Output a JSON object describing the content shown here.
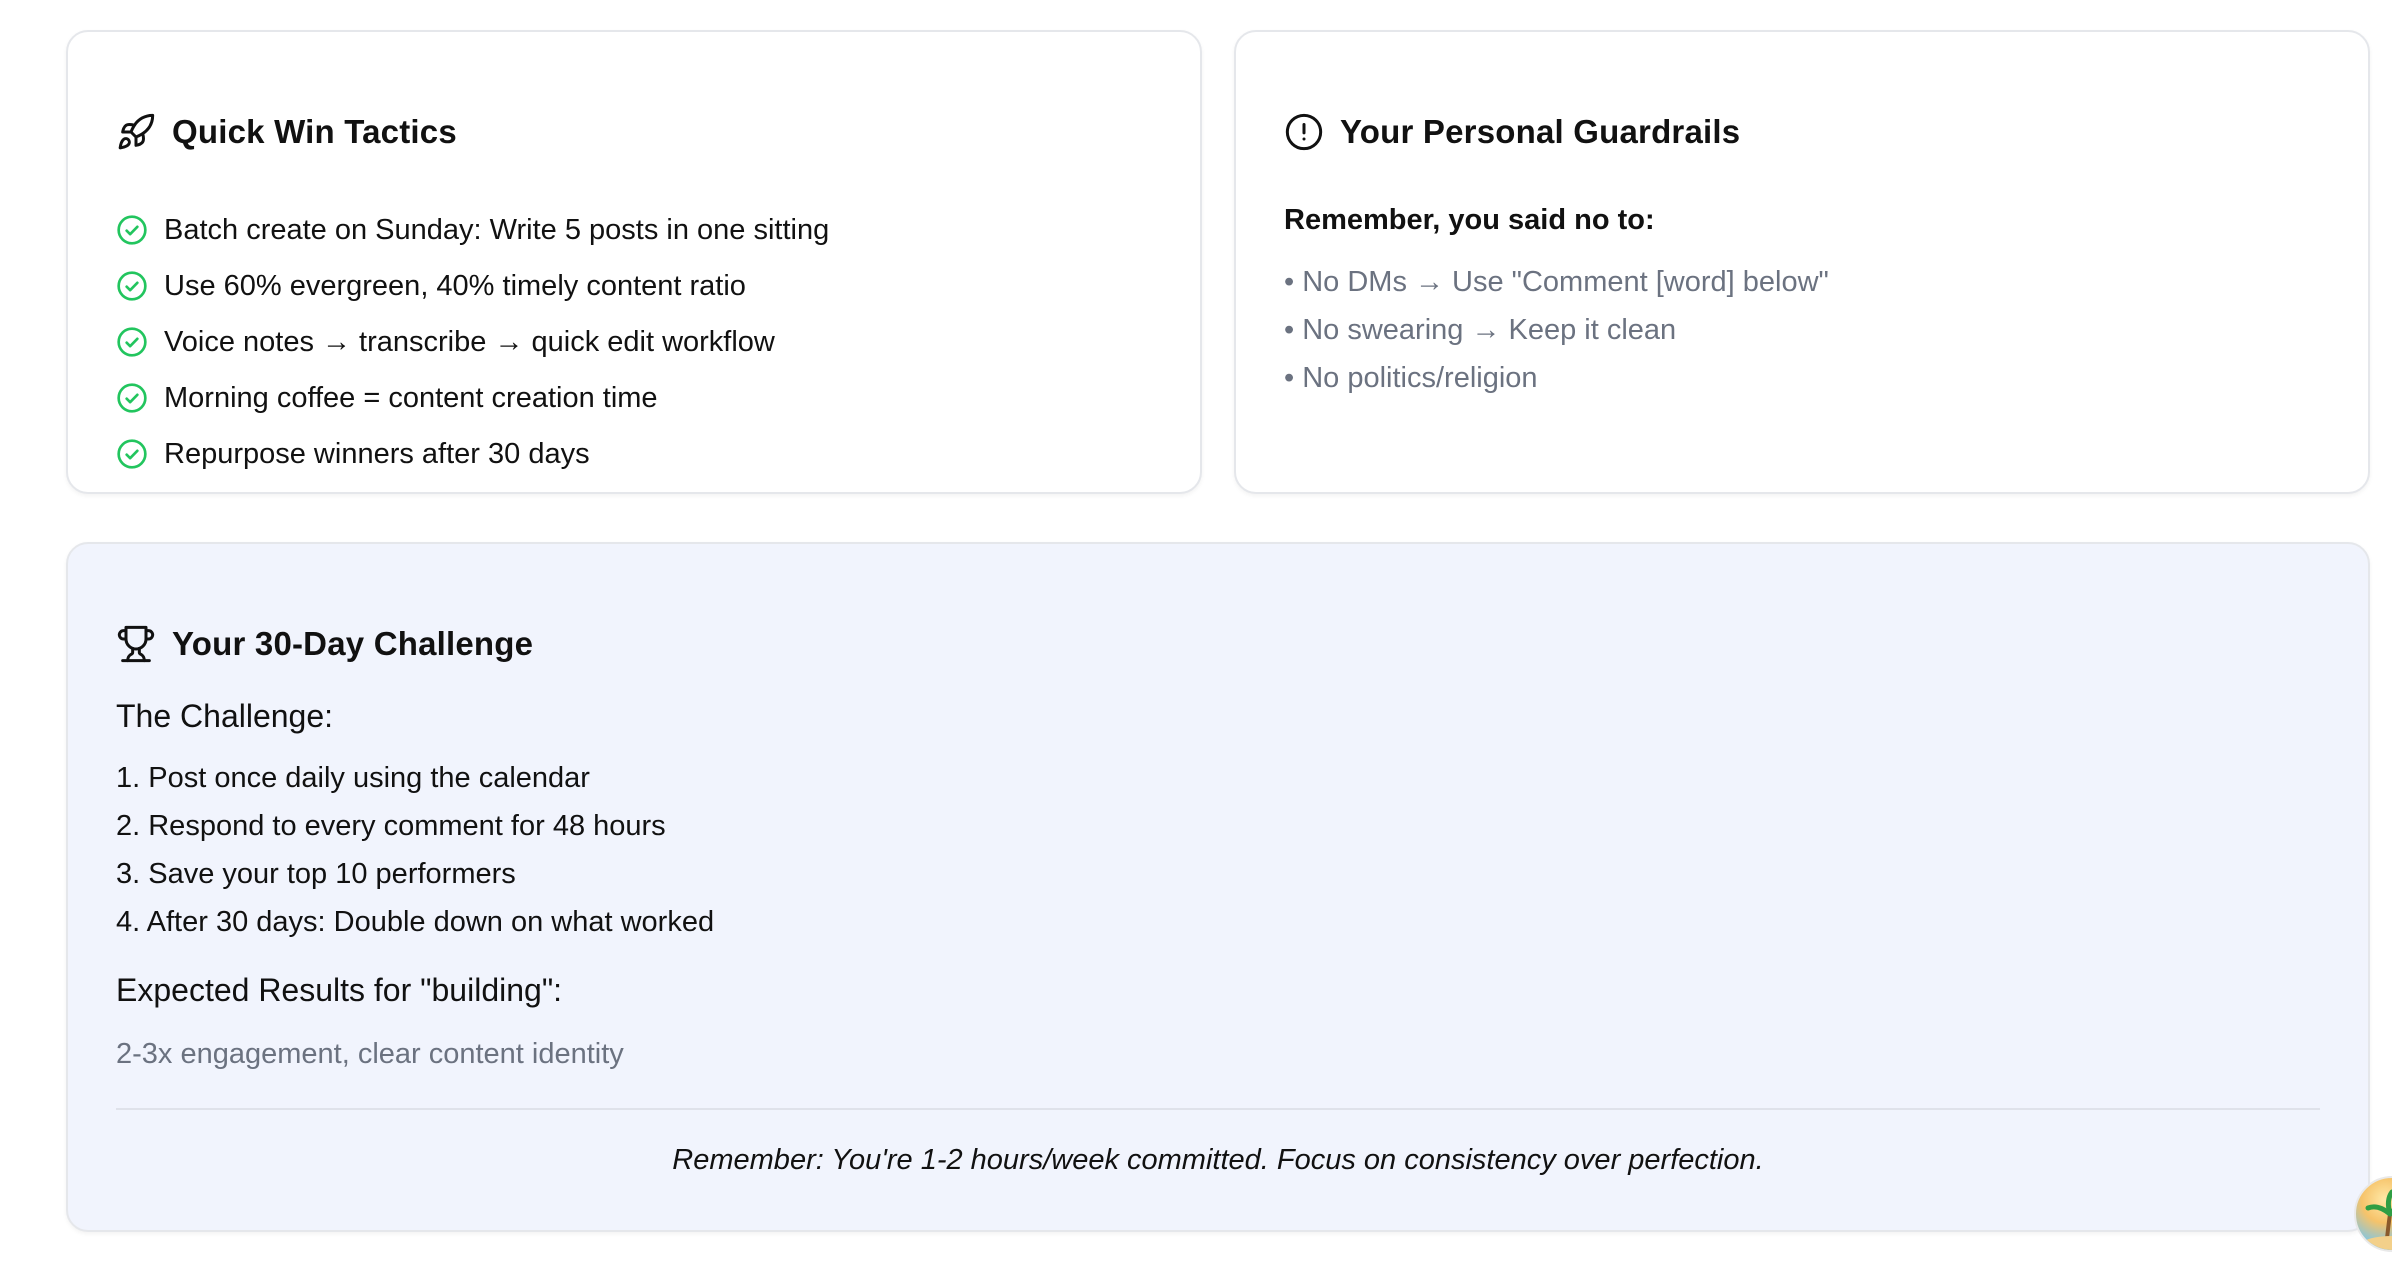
{
  "quick_win": {
    "title": "Quick Win Tactics",
    "icon": "rocket-icon",
    "items": [
      "Batch create on Sunday: Write 5 posts in one sitting",
      "Use 60% evergreen, 40% timely content ratio",
      "Voice notes → transcribe → quick edit workflow",
      "Morning coffee = content creation time",
      "Repurpose winners after 30 days"
    ]
  },
  "guardrails": {
    "title": "Your Personal Guardrails",
    "icon": "alert-circle-icon",
    "label": "Remember, you said no to:",
    "items": [
      "• No DMs → Use \"Comment [word] below\"",
      "• No swearing → Keep it clean",
      "• No politics/religion"
    ]
  },
  "challenge": {
    "title": "Your 30-Day Challenge",
    "icon": "trophy-icon",
    "subtitle": "The Challenge:",
    "steps": [
      "1. Post once daily using the calendar",
      "2. Respond to every comment for 48 hours",
      "3. Save your top 10 performers",
      "4. After 30 days: Double down on what worked"
    ],
    "expected_heading": "Expected Results for \"building\":",
    "expected_text": "2-3x engagement, clear content identity",
    "footer": "Remember: You're 1-2 hours/week committed. Focus on consistency over perfection."
  },
  "colors": {
    "check": "#22c55e",
    "muted_text": "#6b7280",
    "challenge_bg": "#f1f4fd"
  }
}
